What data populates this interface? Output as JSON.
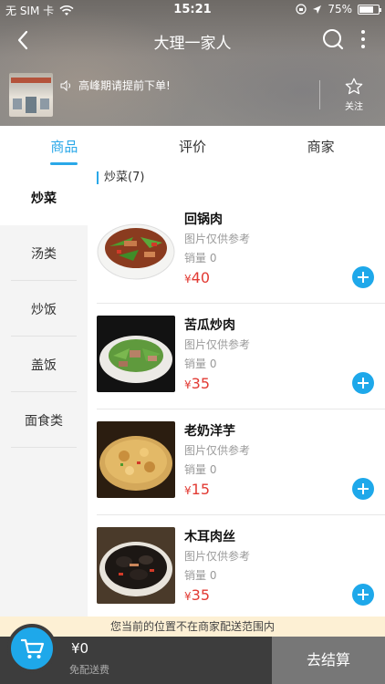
{
  "status": {
    "carrier": "无 SIM 卡",
    "time": "15:21",
    "battery": "75%",
    "battery_fill": 0.75
  },
  "nav": {
    "title": "大理一家人",
    "back_icon": "chevron-left-icon",
    "search_icon": "search-icon",
    "more_icon": "more-vertical-icon"
  },
  "shop": {
    "notice": "高峰期请提前下单!",
    "follow_label": "关注"
  },
  "tabs": [
    {
      "label": "商品",
      "active": true
    },
    {
      "label": "评价",
      "active": false
    },
    {
      "label": "商家",
      "active": false
    }
  ],
  "categories": [
    {
      "label": "炒菜",
      "active": true
    },
    {
      "label": "汤类",
      "active": false
    },
    {
      "label": "炒饭",
      "active": false
    },
    {
      "label": "盖饭",
      "active": false
    },
    {
      "label": "面食类",
      "active": false
    }
  ],
  "section": {
    "title": "炒菜(7)"
  },
  "items": [
    {
      "name": "回锅肉",
      "note": "图片仅供参考",
      "sales": "销量 0",
      "currency": "¥",
      "price": "40"
    },
    {
      "name": "苦瓜炒肉",
      "note": "图片仅供参考",
      "sales": "销量 0",
      "currency": "¥",
      "price": "35"
    },
    {
      "name": "老奶洋芋",
      "note": "图片仅供参考",
      "sales": "销量 0",
      "currency": "¥",
      "price": "15"
    },
    {
      "name": "木耳肉丝",
      "note": "图片仅供参考",
      "sales": "销量 0",
      "currency": "¥",
      "price": "35"
    }
  ],
  "bottom": {
    "warning": "您当前的位置不在商家配送范围内",
    "total": "¥0",
    "delivery_fee": "免配送费",
    "checkout": "去结算"
  },
  "colors": {
    "accent": "#1ea8ea",
    "price": "#e23a33",
    "warning_bg": "#fdf0d4",
    "cart_bar": "#3d3d3d"
  }
}
